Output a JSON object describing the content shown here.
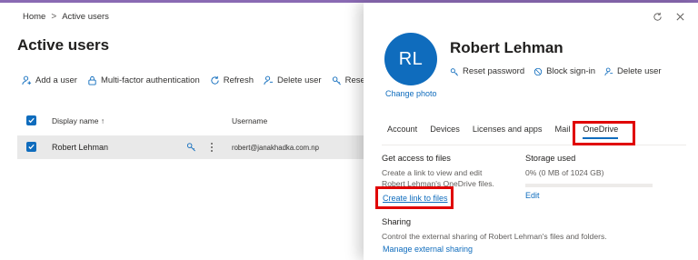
{
  "breadcrumb": {
    "home": "Home",
    "separator": ">",
    "current": "Active users"
  },
  "page_title": "Active users",
  "commands": [
    {
      "label": "Add a user",
      "icon": "person-add-icon"
    },
    {
      "label": "Multi-factor authentication",
      "icon": "lock-icon"
    },
    {
      "label": "Refresh",
      "icon": "refresh-icon"
    },
    {
      "label": "Delete user",
      "icon": "person-delete-icon"
    },
    {
      "label": "Reset passw",
      "icon": "key-icon"
    }
  ],
  "table": {
    "headers": {
      "display_name": "Display name ↑",
      "username": "Username"
    },
    "rows": [
      {
        "display_name": "Robert Lehman",
        "username": "robert@janakhadka.com.np"
      }
    ]
  },
  "panel": {
    "initials": "RL",
    "change_photo": "Change photo",
    "user_name": "Robert Lehman",
    "actions": [
      {
        "label": "Reset password",
        "icon": "key-icon"
      },
      {
        "label": "Block sign-in",
        "icon": "block-icon"
      },
      {
        "label": "Delete user",
        "icon": "person-delete-icon"
      }
    ],
    "tabs": [
      "Account",
      "Devices",
      "Licenses and apps",
      "Mail",
      "OneDrive"
    ],
    "active_tab": "OneDrive",
    "files": {
      "title": "Get access to files",
      "description_line1": "Create a link to view and edit",
      "description_line2": "Robert Lehman's OneDrive files.",
      "link": "Create link to files"
    },
    "storage": {
      "title": "Storage used",
      "value": "0% (0 MB of 1024 GB)",
      "fraction": 0,
      "edit": "Edit"
    },
    "sharing": {
      "title": "Sharing",
      "description": "Control the external sharing of Robert Lehman's files and folders.",
      "link": "Manage external sharing"
    }
  },
  "colors": {
    "accent": "#0f6cbd",
    "highlight": "#e00000",
    "row_selected": "#e9e9e9"
  }
}
